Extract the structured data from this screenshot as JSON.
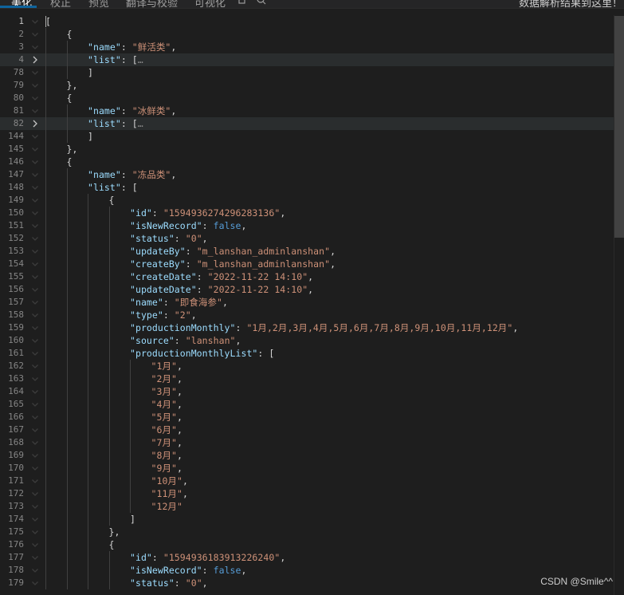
{
  "toolbar": {
    "tabs": [
      "美化",
      "校正",
      "预览",
      "翻译与校验",
      "可视化"
    ],
    "status_text": "数据解析结果到这里！"
  },
  "editor": {
    "lines": [
      {
        "n": "1",
        "cur": true,
        "i": 0,
        "t": [
          [
            "p",
            "["
          ]
        ]
      },
      {
        "n": "2",
        "i": 1,
        "t": [
          [
            "p",
            "{"
          ]
        ]
      },
      {
        "n": "3",
        "i": 2,
        "t": [
          [
            "k",
            "\"name\""
          ],
          [
            "p",
            ": "
          ],
          [
            "s",
            "\"鲜活类\""
          ],
          [
            "p",
            ","
          ]
        ]
      },
      {
        "n": "4",
        "i": 2,
        "hl": true,
        "fold": "collapsed",
        "t": [
          [
            "k",
            "\"list\""
          ],
          [
            "p",
            ": ["
          ],
          [
            "ell",
            "…"
          ]
        ]
      },
      {
        "n": "78",
        "i": 2,
        "t": [
          [
            "p",
            "]"
          ]
        ]
      },
      {
        "n": "79",
        "i": 1,
        "t": [
          [
            "p",
            "},"
          ]
        ]
      },
      {
        "n": "80",
        "i": 1,
        "t": [
          [
            "p",
            "{"
          ]
        ]
      },
      {
        "n": "81",
        "i": 2,
        "t": [
          [
            "k",
            "\"name\""
          ],
          [
            "p",
            ": "
          ],
          [
            "s",
            "\"冰鲜类\""
          ],
          [
            "p",
            ","
          ]
        ]
      },
      {
        "n": "82",
        "i": 2,
        "hl": true,
        "fold": "collapsed",
        "t": [
          [
            "k",
            "\"list\""
          ],
          [
            "p",
            ": ["
          ],
          [
            "ell",
            "…"
          ]
        ]
      },
      {
        "n": "144",
        "i": 2,
        "t": [
          [
            "p",
            "]"
          ]
        ]
      },
      {
        "n": "145",
        "i": 1,
        "t": [
          [
            "p",
            "},"
          ]
        ]
      },
      {
        "n": "146",
        "i": 1,
        "t": [
          [
            "p",
            "{"
          ]
        ]
      },
      {
        "n": "147",
        "i": 2,
        "t": [
          [
            "k",
            "\"name\""
          ],
          [
            "p",
            ": "
          ],
          [
            "s",
            "\"冻品类\""
          ],
          [
            "p",
            ","
          ]
        ]
      },
      {
        "n": "148",
        "i": 2,
        "t": [
          [
            "k",
            "\"list\""
          ],
          [
            "p",
            ": ["
          ]
        ]
      },
      {
        "n": "149",
        "i": 3,
        "t": [
          [
            "p",
            "{"
          ]
        ]
      },
      {
        "n": "150",
        "i": 4,
        "t": [
          [
            "k",
            "\"id\""
          ],
          [
            "p",
            ": "
          ],
          [
            "s",
            "\"1594936274296283136\""
          ],
          [
            "p",
            ","
          ]
        ]
      },
      {
        "n": "151",
        "i": 4,
        "t": [
          [
            "k",
            "\"isNewRecord\""
          ],
          [
            "p",
            ": "
          ],
          [
            "b",
            "false"
          ],
          [
            "p",
            ","
          ]
        ]
      },
      {
        "n": "152",
        "i": 4,
        "t": [
          [
            "k",
            "\"status\""
          ],
          [
            "p",
            ": "
          ],
          [
            "s",
            "\"0\""
          ],
          [
            "p",
            ","
          ]
        ]
      },
      {
        "n": "153",
        "i": 4,
        "t": [
          [
            "k",
            "\"updateBy\""
          ],
          [
            "p",
            ": "
          ],
          [
            "s",
            "\"m_lanshan_adminlanshan\""
          ],
          [
            "p",
            ","
          ]
        ]
      },
      {
        "n": "154",
        "i": 4,
        "t": [
          [
            "k",
            "\"createBy\""
          ],
          [
            "p",
            ": "
          ],
          [
            "s",
            "\"m_lanshan_adminlanshan\""
          ],
          [
            "p",
            ","
          ]
        ]
      },
      {
        "n": "155",
        "i": 4,
        "t": [
          [
            "k",
            "\"createDate\""
          ],
          [
            "p",
            ": "
          ],
          [
            "s",
            "\"2022-11-22 14:10\""
          ],
          [
            "p",
            ","
          ]
        ]
      },
      {
        "n": "156",
        "i": 4,
        "t": [
          [
            "k",
            "\"updateDate\""
          ],
          [
            "p",
            ": "
          ],
          [
            "s",
            "\"2022-11-22 14:10\""
          ],
          [
            "p",
            ","
          ]
        ]
      },
      {
        "n": "157",
        "i": 4,
        "t": [
          [
            "k",
            "\"name\""
          ],
          [
            "p",
            ": "
          ],
          [
            "s",
            "\"即食海参\""
          ],
          [
            "p",
            ","
          ]
        ]
      },
      {
        "n": "158",
        "i": 4,
        "t": [
          [
            "k",
            "\"type\""
          ],
          [
            "p",
            ": "
          ],
          [
            "s",
            "\"2\""
          ],
          [
            "p",
            ","
          ]
        ]
      },
      {
        "n": "159",
        "i": 4,
        "t": [
          [
            "k",
            "\"productionMonthly\""
          ],
          [
            "p",
            ": "
          ],
          [
            "s",
            "\"1月,2月,3月,4月,5月,6月,7月,8月,9月,10月,11月,12月\""
          ],
          [
            "p",
            ","
          ]
        ]
      },
      {
        "n": "160",
        "i": 4,
        "t": [
          [
            "k",
            "\"source\""
          ],
          [
            "p",
            ": "
          ],
          [
            "s",
            "\"lanshan\""
          ],
          [
            "p",
            ","
          ]
        ]
      },
      {
        "n": "161",
        "i": 4,
        "t": [
          [
            "k",
            "\"productionMonthlyList\""
          ],
          [
            "p",
            ": ["
          ]
        ]
      },
      {
        "n": "162",
        "i": 5,
        "t": [
          [
            "s",
            "\"1月\""
          ],
          [
            "p",
            ","
          ]
        ]
      },
      {
        "n": "163",
        "i": 5,
        "t": [
          [
            "s",
            "\"2月\""
          ],
          [
            "p",
            ","
          ]
        ]
      },
      {
        "n": "164",
        "i": 5,
        "t": [
          [
            "s",
            "\"3月\""
          ],
          [
            "p",
            ","
          ]
        ]
      },
      {
        "n": "165",
        "i": 5,
        "t": [
          [
            "s",
            "\"4月\""
          ],
          [
            "p",
            ","
          ]
        ]
      },
      {
        "n": "166",
        "i": 5,
        "t": [
          [
            "s",
            "\"5月\""
          ],
          [
            "p",
            ","
          ]
        ]
      },
      {
        "n": "167",
        "i": 5,
        "t": [
          [
            "s",
            "\"6月\""
          ],
          [
            "p",
            ","
          ]
        ]
      },
      {
        "n": "168",
        "i": 5,
        "t": [
          [
            "s",
            "\"7月\""
          ],
          [
            "p",
            ","
          ]
        ]
      },
      {
        "n": "169",
        "i": 5,
        "t": [
          [
            "s",
            "\"8月\""
          ],
          [
            "p",
            ","
          ]
        ]
      },
      {
        "n": "170",
        "i": 5,
        "t": [
          [
            "s",
            "\"9月\""
          ],
          [
            "p",
            ","
          ]
        ]
      },
      {
        "n": "171",
        "i": 5,
        "t": [
          [
            "s",
            "\"10月\""
          ],
          [
            "p",
            ","
          ]
        ]
      },
      {
        "n": "172",
        "i": 5,
        "t": [
          [
            "s",
            "\"11月\""
          ],
          [
            "p",
            ","
          ]
        ]
      },
      {
        "n": "173",
        "i": 5,
        "t": [
          [
            "s",
            "\"12月\""
          ]
        ]
      },
      {
        "n": "174",
        "i": 4,
        "t": [
          [
            "p",
            "]"
          ]
        ]
      },
      {
        "n": "175",
        "i": 3,
        "t": [
          [
            "p",
            "},"
          ]
        ]
      },
      {
        "n": "176",
        "i": 3,
        "t": [
          [
            "p",
            "{"
          ]
        ]
      },
      {
        "n": "177",
        "i": 4,
        "t": [
          [
            "k",
            "\"id\""
          ],
          [
            "p",
            ": "
          ],
          [
            "s",
            "\"1594936183913226240\""
          ],
          [
            "p",
            ","
          ]
        ]
      },
      {
        "n": "178",
        "i": 4,
        "t": [
          [
            "k",
            "\"isNewRecord\""
          ],
          [
            "p",
            ": "
          ],
          [
            "b",
            "false"
          ],
          [
            "p",
            ","
          ]
        ]
      },
      {
        "n": "179",
        "i": 4,
        "t": [
          [
            "k",
            "\"status\""
          ],
          [
            "p",
            ": "
          ],
          [
            "s",
            "\"0\""
          ],
          [
            "p",
            ","
          ]
        ]
      }
    ]
  },
  "watermark": "CSDN @Smile^^"
}
